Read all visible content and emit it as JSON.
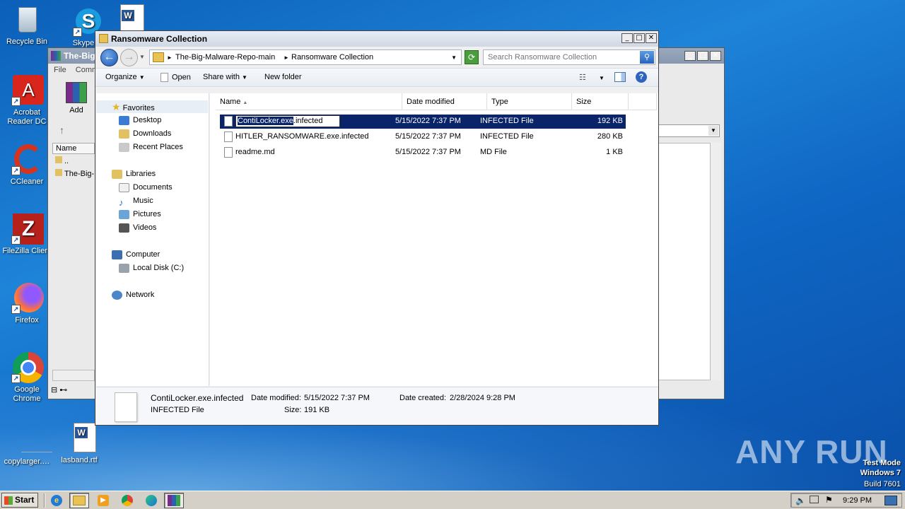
{
  "desktop": {
    "icons": [
      {
        "label": "Recycle Bin",
        "icon": "recycle-bin-icon"
      },
      {
        "label": "Skype",
        "icon": "skype-icon"
      },
      {
        "label": "Acrobat Reader DC",
        "icon": "acrobat-icon"
      },
      {
        "label": "CCleaner",
        "icon": "ccleaner-icon"
      },
      {
        "label": "FileZilla Client",
        "icon": "filezilla-icon"
      },
      {
        "label": "Firefox",
        "icon": "firefox-icon"
      },
      {
        "label": "Google Chrome",
        "icon": "chrome-icon"
      },
      {
        "label": "copylarger.…",
        "icon": "blank-file-icon"
      },
      {
        "label": "lasband.rtf",
        "icon": "word-doc-icon"
      }
    ],
    "watermark": "ANY RUN",
    "test_mode": {
      "line1": "Test Mode",
      "line2": "Windows 7",
      "line3": "Build 7601"
    }
  },
  "back_window": {
    "title": "The-Big-",
    "menu": [
      "File",
      "Comm"
    ],
    "add_label": "Add",
    "name_col": "Name",
    "rows": [
      "..",
      "The-Big-"
    ]
  },
  "explorer": {
    "title": "Ransomware Collection",
    "breadcrumbs": [
      "The-Big-Malware-Repo-main",
      "Ransomware Collection"
    ],
    "search_placeholder": "Search Ransomware Collection",
    "toolbar": {
      "organize": "Organize",
      "open": "Open",
      "share_with": "Share with",
      "new_folder": "New folder"
    },
    "nav": {
      "favorites": "Favorites",
      "favorites_items": [
        "Desktop",
        "Downloads",
        "Recent Places"
      ],
      "libraries": "Libraries",
      "libraries_items": [
        "Documents",
        "Music",
        "Pictures",
        "Videos"
      ],
      "computer": "Computer",
      "computer_items": [
        "Local Disk (C:)"
      ],
      "network": "Network"
    },
    "columns": {
      "name": "Name",
      "date": "Date modified",
      "type": "Type",
      "size": "Size"
    },
    "files": [
      {
        "name": "ContiLocker.exe.infected",
        "rename_selected": "ContiLocker.exe",
        "rename_rest": ".infected",
        "date": "5/15/2022 7:37 PM",
        "type": "INFECTED File",
        "size": "192 KB"
      },
      {
        "name": "HITLER_RANSOMWARE.exe.infected",
        "date": "5/15/2022 7:37 PM",
        "type": "INFECTED File",
        "size": "280 KB"
      },
      {
        "name": "readme.md",
        "date": "5/15/2022 7:37 PM",
        "type": "MD File",
        "size": "1 KB"
      }
    ],
    "details": {
      "filename": "ContiLocker.exe.infected",
      "filetype": "INFECTED File",
      "date_modified_label": "Date modified:",
      "date_modified": "5/15/2022 7:37 PM",
      "size_label": "Size:",
      "size": "191 KB",
      "date_created_label": "Date created:",
      "date_created": "2/28/2024 9:28 PM"
    }
  },
  "taskbar": {
    "start": "Start",
    "clock": "9:29 PM"
  }
}
